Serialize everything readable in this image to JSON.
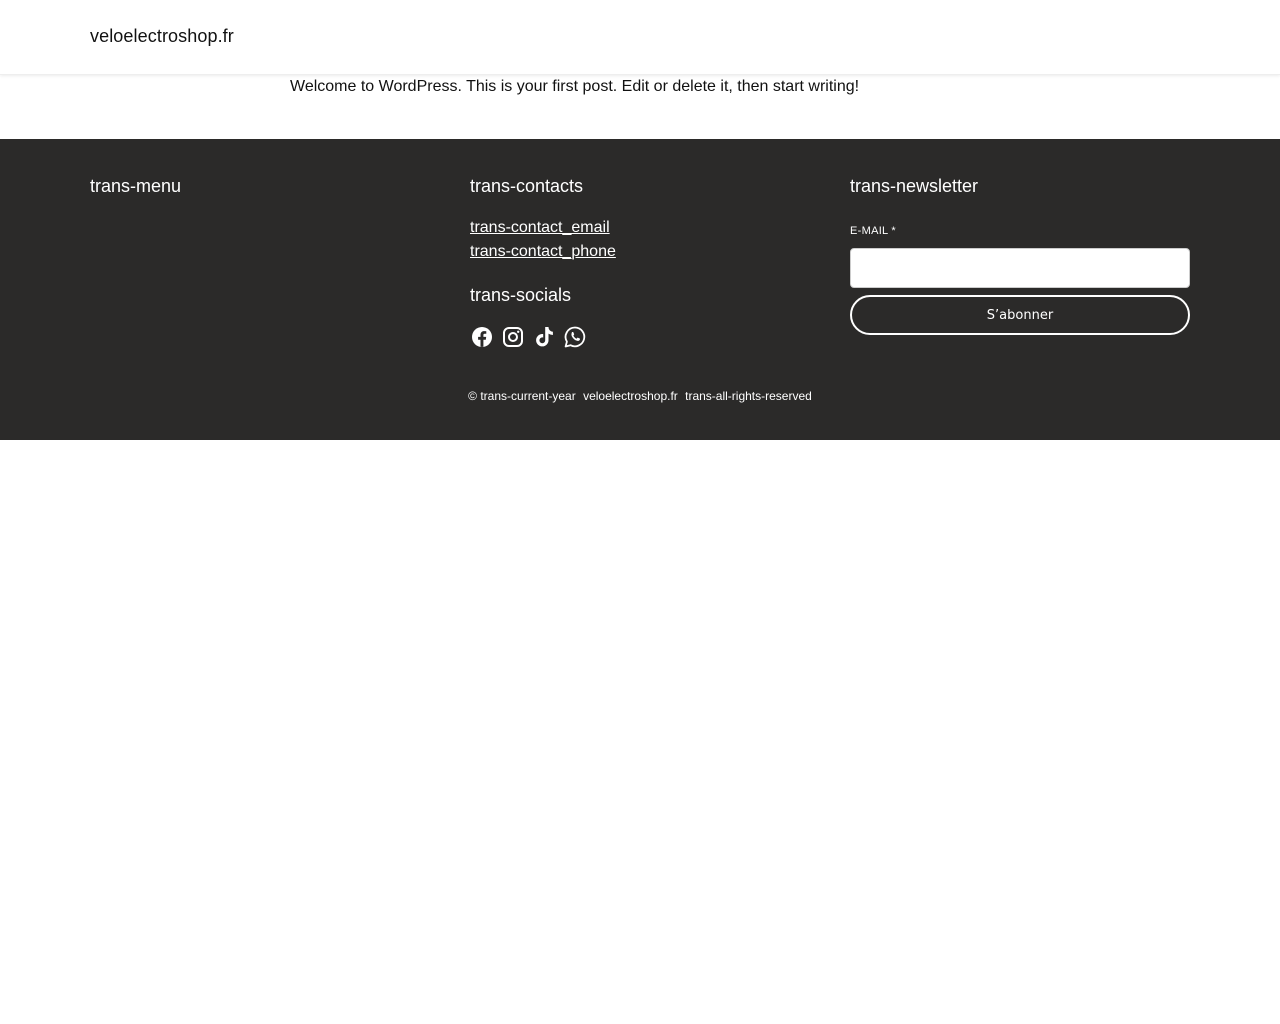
{
  "header": {
    "site_title": "veloelectroshop.fr"
  },
  "main": {
    "post_excerpt": "Welcome to WordPress. This is your first post. Edit or delete it, then start writing!"
  },
  "footer": {
    "menu_title": "trans-menu",
    "contacts_title": "trans-contacts",
    "contact_email": "trans-contact_email",
    "contact_phone": "trans-contact_phone",
    "socials_title": "trans-socials",
    "socials": [
      {
        "icon": "facebook-icon"
      },
      {
        "icon": "instagram-icon"
      },
      {
        "icon": "tiktok-icon"
      },
      {
        "icon": "whatsapp-icon"
      }
    ],
    "newsletter_title": "trans-newsletter",
    "email_label": "E-MAIL *",
    "email_value": "",
    "subscribe_label": "S’abonner",
    "copyright": {
      "year": "© trans-current-year",
      "site": "veloelectroshop.fr",
      "rights": "trans-all-rights-reserved"
    }
  },
  "colors": {
    "footer_bg": "#2b2a29",
    "text_dark": "#111111",
    "text_light": "#ffffff"
  }
}
